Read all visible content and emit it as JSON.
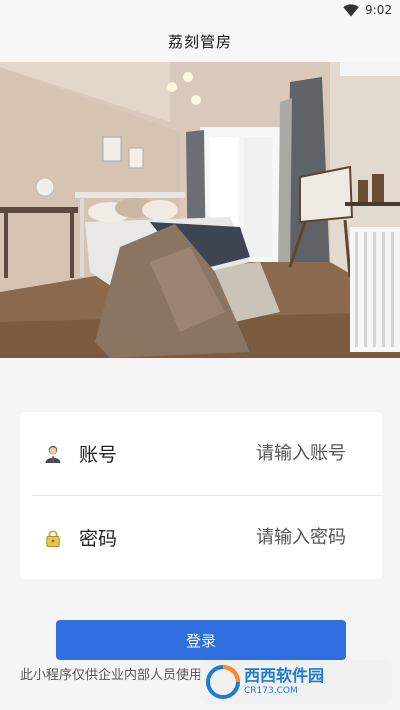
{
  "status_bar": {
    "time": "9:02",
    "wifi_icon": "wifi-icon"
  },
  "header": {
    "title": "荔刻管房"
  },
  "hero": {
    "image": "bedroom-photo"
  },
  "form": {
    "account": {
      "icon": "user-icon",
      "label": "账号",
      "placeholder": "请输入账号",
      "value": ""
    },
    "password": {
      "icon": "lock-icon",
      "label": "密码",
      "placeholder": "请输入密码",
      "value": ""
    }
  },
  "login_button": {
    "label": "登录",
    "color": "#2f6fe0"
  },
  "notice": "此小程序仅供企业内部人员使用",
  "watermark": {
    "logo": "西西",
    "name": "软件园",
    "url": "CR173.COM"
  }
}
